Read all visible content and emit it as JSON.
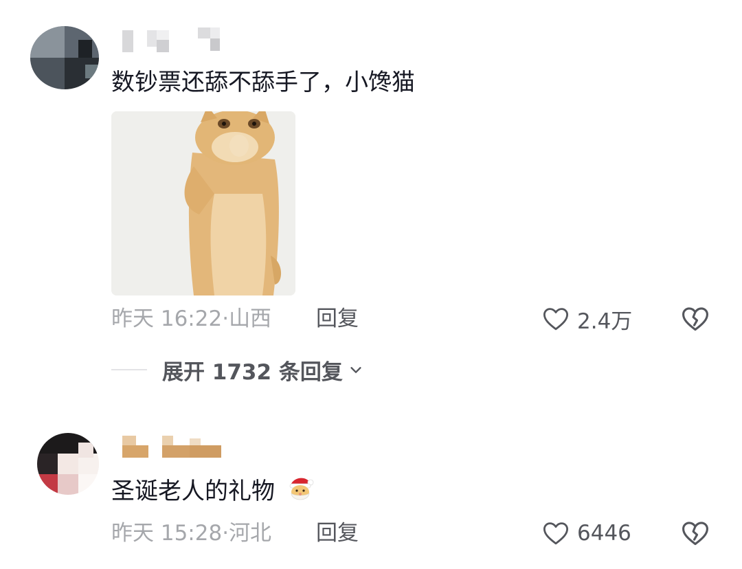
{
  "comments": [
    {
      "text": "数钞票还舔不舔手了，小馋猫",
      "time": "昨天 16:22",
      "location": "山西",
      "reply_label": "回复",
      "likes": "2.4万",
      "has_sticker": true,
      "expand_label": "展开 1732 条回复"
    },
    {
      "text": "圣诞老人的礼物",
      "emoji": "santa-claus-emoji",
      "time": "昨天 15:28",
      "location": "河北",
      "reply_label": "回复",
      "likes": "6446"
    }
  ],
  "colors": {
    "primary_text": "#161823",
    "secondary_text": "#a5a7ab",
    "action_text": "#54565c",
    "background": "#ffffff"
  }
}
